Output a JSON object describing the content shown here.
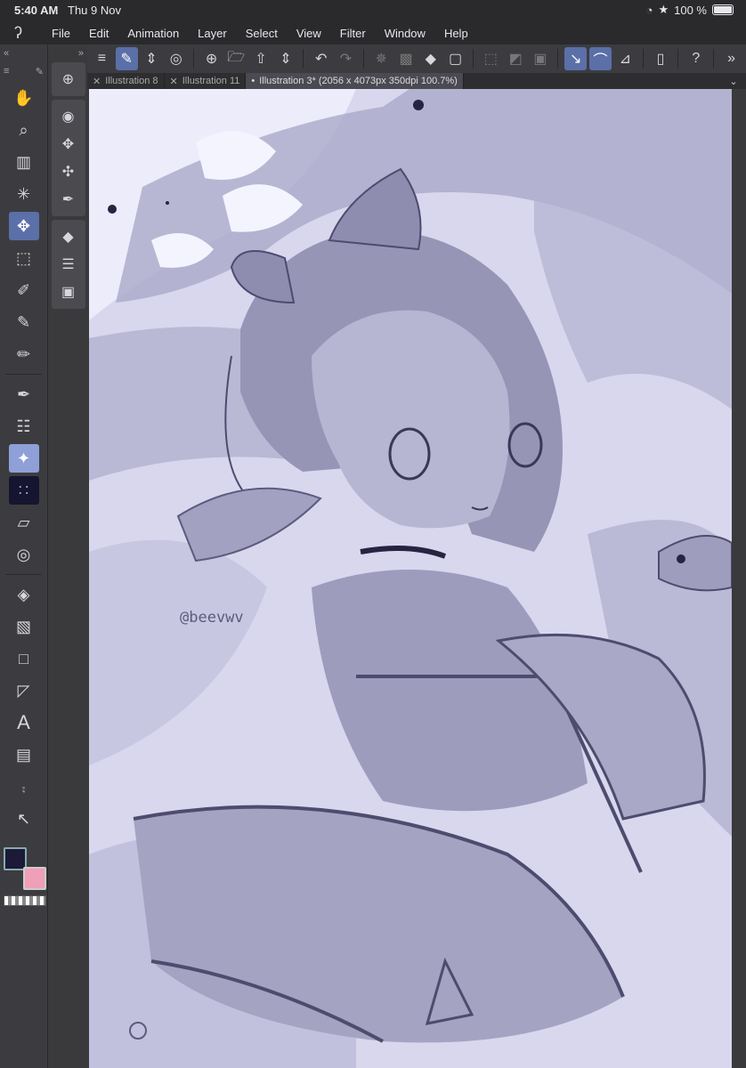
{
  "status": {
    "time": "5:40 AM",
    "date": "Thu 9 Nov",
    "battery": "100 %"
  },
  "menu": [
    "File",
    "Edit",
    "Animation",
    "Layer",
    "Select",
    "View",
    "Filter",
    "Window",
    "Help"
  ],
  "tabs": [
    {
      "label": "Illustration 8"
    },
    {
      "label": "Illustration 11"
    },
    {
      "label": "Illustration 3* (2056 x 4073px 350dpi 100.7%)"
    }
  ],
  "canvas": {
    "watermark": "@beevwv"
  },
  "colors": {
    "main": "#1c1a38",
    "sub": "#ef9fb8",
    "accent": "#5b6fa8"
  }
}
